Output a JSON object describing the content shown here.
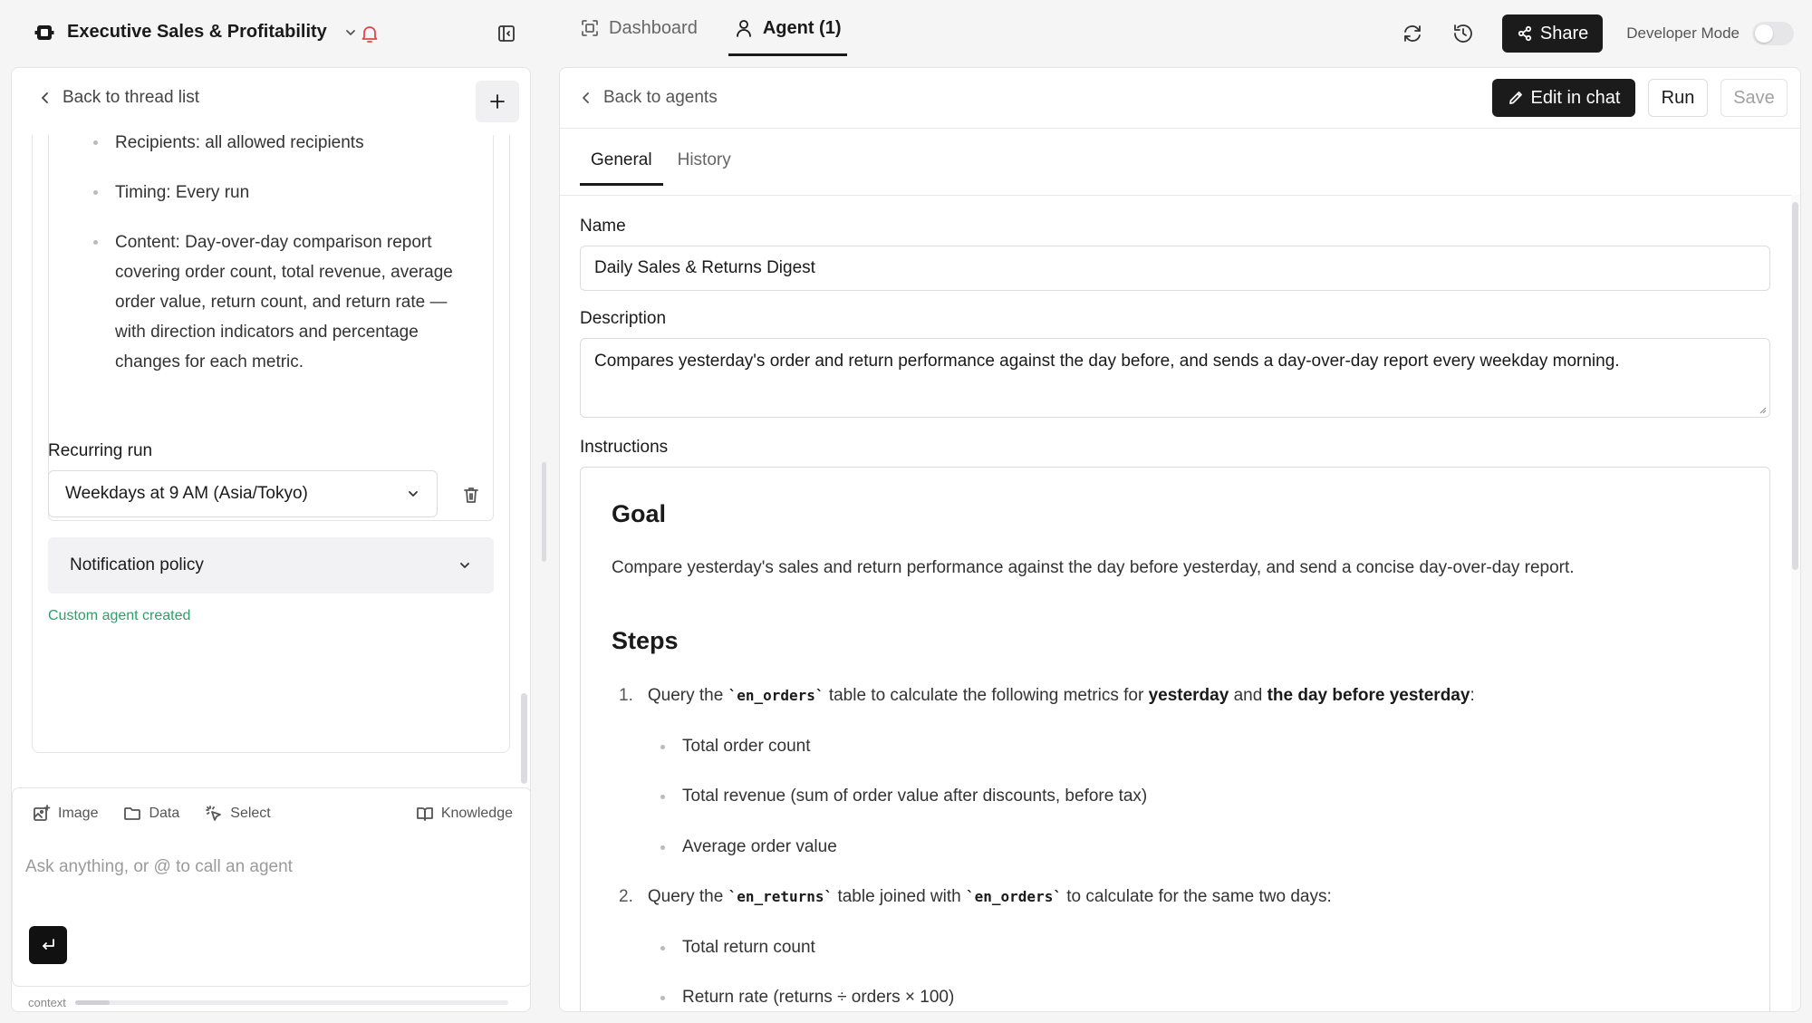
{
  "header": {
    "workspace_title": "Executive Sales & Profitability",
    "tabs": [
      {
        "label": "Dashboard",
        "icon": "scan-icon",
        "active": false
      },
      {
        "label": "Agent (1)",
        "icon": "user-icon",
        "active": true
      }
    ],
    "share_label": "Share",
    "developer_mode_label": "Developer Mode",
    "developer_mode_on": false
  },
  "left": {
    "back_label": "Back to thread list",
    "bullets": [
      "Recipients: all allowed recipients",
      "Timing: Every run",
      "Content: Day-over-day comparison report covering order count, total revenue, average order value, return count, and return rate — with direction indicators and percentage changes for each metric."
    ],
    "recurring_label": "Recurring run",
    "recurring_value": "Weekdays at 9 AM (Asia/Tokyo)",
    "notification_label": "Notification policy",
    "created_label": "Custom agent created",
    "composer": {
      "tools": [
        "Image",
        "Data",
        "Select"
      ],
      "knowledge_label": "Knowledge",
      "placeholder": "Ask anything, or @ to call an agent",
      "context_label": "context",
      "context_fill": 0.08
    }
  },
  "right": {
    "back_label": "Back to agents",
    "edit_label": "Edit in chat",
    "run_label": "Run",
    "save_label": "Save",
    "tabs": [
      {
        "label": "General",
        "active": true
      },
      {
        "label": "History",
        "active": false
      }
    ],
    "name_label": "Name",
    "name_value": "Daily Sales & Returns Digest",
    "description_label": "Description",
    "description_value": "Compares yesterday's order and return performance against the day before, and sends a day-over-day report every weekday morning.",
    "instructions_label": "Instructions",
    "instructions": {
      "goal_heading": "Goal",
      "goal_text": "Compare yesterday's sales and return performance against the day before yesterday, and send a concise day-over-day report.",
      "steps_heading": "Steps",
      "step1": {
        "num": "1.",
        "pre": "Query the ",
        "code": "`en_orders`",
        "mid": " table to calculate the following metrics for ",
        "b1": "yesterday",
        "and": " and ",
        "b2": "the day before yesterday",
        "end": ":"
      },
      "step1_items": [
        "Total order count",
        "Total revenue (sum of order value after discounts, before tax)",
        "Average order value"
      ],
      "step2": {
        "num": "2.",
        "pre": "Query the ",
        "code1": "`en_returns`",
        "mid": " table joined with ",
        "code2": "`en_orders`",
        "end": " to calculate for the same two days:"
      },
      "step2_items": [
        "Total return count",
        "Return rate (returns ÷ orders × 100)"
      ]
    }
  }
}
